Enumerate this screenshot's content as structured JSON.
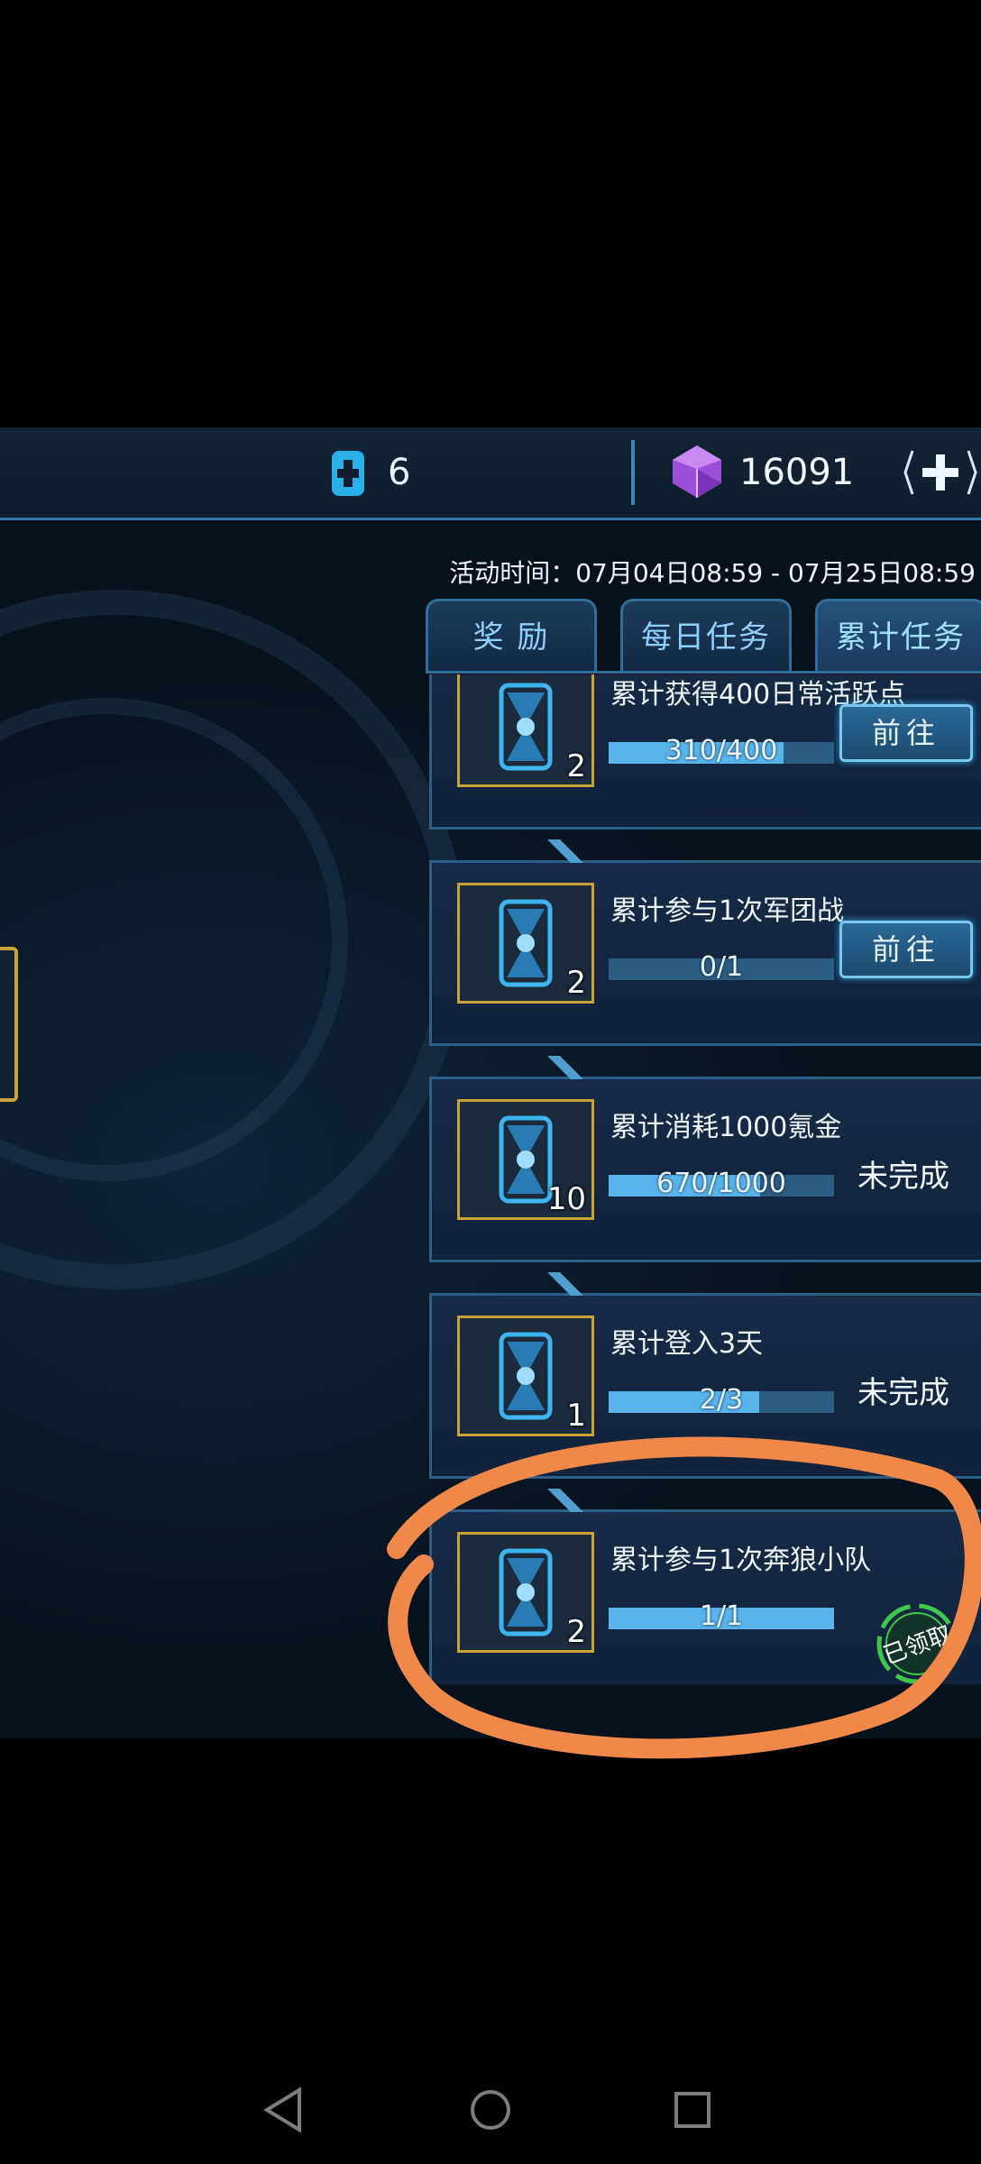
{
  "header": {
    "energy_value": "6",
    "gem_value": "16091"
  },
  "event_period": "活动时间：07月04日08:59 - 07月25日08:59",
  "tabs": [
    {
      "label": "奖 励",
      "active": false
    },
    {
      "label": "每日任务",
      "active": false
    },
    {
      "label": "累计任务",
      "active": true
    }
  ],
  "tasks": [
    {
      "title": "累计获得400日常活跃点",
      "reward_qty": "2",
      "progress_text": "310/400",
      "progress": 0.775,
      "action": "前往",
      "state": "go"
    },
    {
      "title": "累计参与1次军团战",
      "reward_qty": "2",
      "progress_text": "0/1",
      "progress": 0.0,
      "action": "前往",
      "state": "go"
    },
    {
      "title": "累计消耗1000氪金",
      "reward_qty": "10",
      "progress_text": "670/1000",
      "progress": 0.67,
      "action": "未完成",
      "state": "incomplete"
    },
    {
      "title": "累计登入3天",
      "reward_qty": "1",
      "progress_text": "2/3",
      "progress": 0.667,
      "action": "未完成",
      "state": "incomplete"
    },
    {
      "title": "累计参与1次奔狼小队",
      "reward_qty": "2",
      "progress_text": "1/1",
      "progress": 1.0,
      "action": "已领取",
      "state": "claimed"
    }
  ],
  "colors": {
    "accent": "#59b4ec",
    "gold_frame": "#c8a33a",
    "claimed_green": "#3fc94a",
    "annotation_orange": "#f0884a"
  },
  "icons": {
    "energy": "energy-cross-icon",
    "gem": "purple-gem-icon",
    "add": "plus-icon",
    "reward": "card-item-icon",
    "nav_back": "back-triangle-icon",
    "nav_home": "home-circle-icon",
    "nav_recent": "recent-square-icon"
  }
}
